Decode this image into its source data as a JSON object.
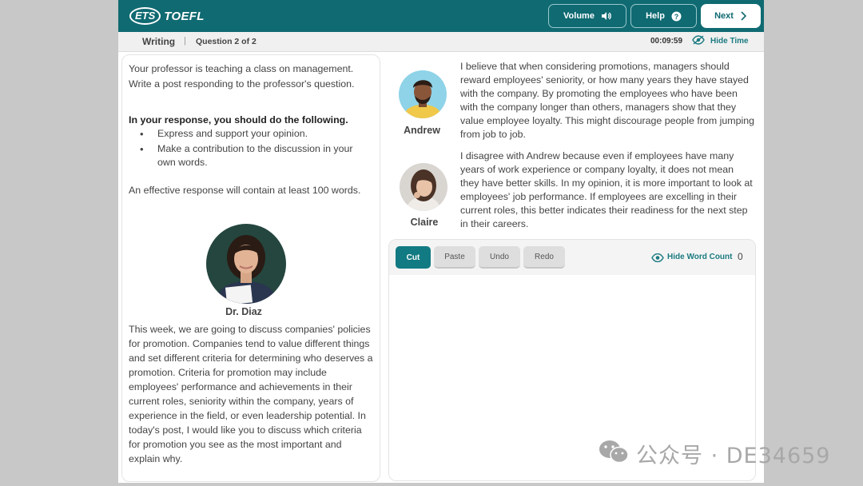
{
  "header": {
    "logo_mark": "ETS",
    "logo_text": "TOEFL",
    "volume_label": "Volume",
    "help_label": "Help",
    "next_label": "Next"
  },
  "subheader": {
    "section": "Writing",
    "separator": "|",
    "question": "Question 2 of 2",
    "timer": "00:09:59",
    "hide_time_label": "Hide Time"
  },
  "prompt": {
    "intro": "Your professor is teaching a class on management. Write a post responding to the professor's question.",
    "instructions_title": "In your response, you should do the following.",
    "bullets": [
      "Express and support your opinion.",
      "Make a contribution to the discussion in your own words."
    ],
    "length_note": "An effective response will contain at least 100 words."
  },
  "professor": {
    "name": "Dr. Diaz",
    "text": "This week, we are going to discuss companies' policies for promotion. Companies tend to value different things and set different criteria for determining who deserves a promotion. Criteria for promotion may include employees' performance and achievements in their current roles, seniority within the company, years of experience in the field, or even leadership potential. In today's post, I would like you to discuss which criteria for promotion you see as the most important and explain why."
  },
  "students": [
    {
      "name": "Andrew",
      "text": "I believe that when considering promotions, managers should reward employees' seniority, or how many years they have stayed with the company. By promoting the employees who have been with the company longer than others, managers show that they value employee loyalty. This might discourage people from jumping from job to job."
    },
    {
      "name": "Claire",
      "text": "I disagree with Andrew because even if employees have many years of work experience or company loyalty, it does not mean they have better skills. In my opinion, it is more important to look at employees' job performance. If employees are excelling in their current roles, this better indicates their readiness for the next step in their careers."
    }
  ],
  "editor": {
    "cut_label": "Cut",
    "paste_label": "Paste",
    "undo_label": "Undo",
    "redo_label": "Redo",
    "hide_word_count_label": "Hide Word Count",
    "word_count": "0",
    "value": ""
  },
  "watermark": {
    "text": "公众号 · DE34659"
  },
  "colors": {
    "brand": "#106a72",
    "accent": "#127a82",
    "page_gutter": "#c8c8c8"
  }
}
